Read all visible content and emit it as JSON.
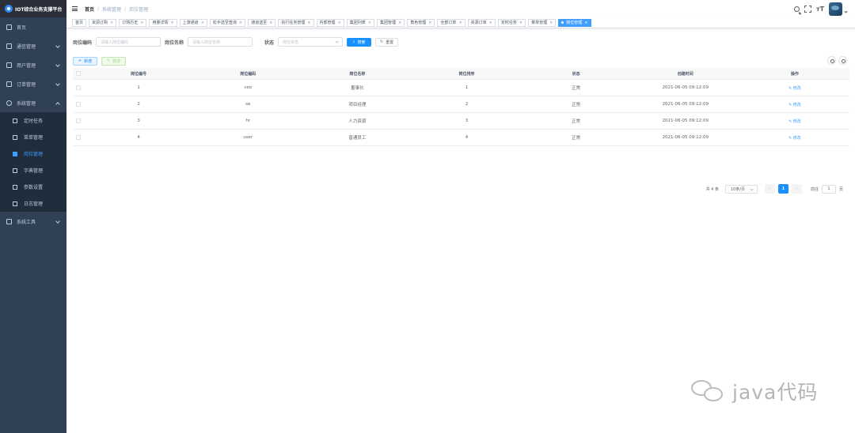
{
  "app": {
    "logo_text": "IOT综合业务支撑平台"
  },
  "sidebar": {
    "items": [
      {
        "label": "首页"
      },
      {
        "label": "通信管理"
      },
      {
        "label": "用户管理"
      },
      {
        "label": "订单管理"
      },
      {
        "label": "系统管理"
      }
    ],
    "subitems": [
      {
        "label": "定时任务"
      },
      {
        "label": "菜单管理"
      },
      {
        "label": "岗位管理"
      },
      {
        "label": "字典管理"
      },
      {
        "label": "参数设置"
      },
      {
        "label": "日志管理"
      }
    ],
    "tools": {
      "label": "系统工具"
    }
  },
  "breadcrumb": {
    "home": "首页",
    "parent": "系统管理",
    "current": "岗位管理",
    "sep": "/"
  },
  "tags": [
    "首页",
    "资源订购",
    "订购历史",
    "用量详情",
    "上游通道",
    "松手送至查询",
    "通道送至",
    "执行任务管理",
    "内部管理",
    "集团列表",
    "集团管理",
    "角色管理",
    "全部订单",
    "资源订单",
    "定时任务",
    "菜单管理",
    "岗位管理"
  ],
  "search": {
    "code_label": "岗位编码",
    "code_placeholder": "请输入岗位编码",
    "name_label": "岗位名称",
    "name_placeholder": "请输入岗位名称",
    "status_label": "状态",
    "status_placeholder": "岗位状态",
    "search_btn": "搜索",
    "reset_btn": "重置"
  },
  "toolbar": {
    "add_btn": "新增",
    "edit_btn": "修改"
  },
  "table": {
    "headers": [
      "岗位编号",
      "岗位编码",
      "岗位名称",
      "岗位排序",
      "状态",
      "创建时间",
      "操作"
    ],
    "rows": [
      {
        "id": "1",
        "code": "ceo",
        "name": "董事长",
        "sort": "1",
        "status": "正常",
        "created": "2021-06-05 09:12:09",
        "action": "修改"
      },
      {
        "id": "2",
        "code": "se",
        "name": "项目经理",
        "sort": "2",
        "status": "正常",
        "created": "2021-06-05 09:12:09",
        "action": "修改"
      },
      {
        "id": "3",
        "code": "hr",
        "name": "人力资源",
        "sort": "3",
        "status": "正常",
        "created": "2021-06-05 09:12:09",
        "action": "修改"
      },
      {
        "id": "4",
        "code": "user",
        "name": "普通员工",
        "sort": "4",
        "status": "正常",
        "created": "2021-06-05 09:12:09",
        "action": "修改"
      }
    ]
  },
  "pagination": {
    "total": "共 4 条",
    "page_size": "10条/页",
    "current": "1",
    "goto_prefix": "前往",
    "goto_value": "1",
    "goto_suffix": "页"
  },
  "watermark": {
    "text": "java代码"
  },
  "colors": {
    "sidebar_bg": "#304156",
    "accent": "#409eff",
    "primary": "#1890ff"
  }
}
